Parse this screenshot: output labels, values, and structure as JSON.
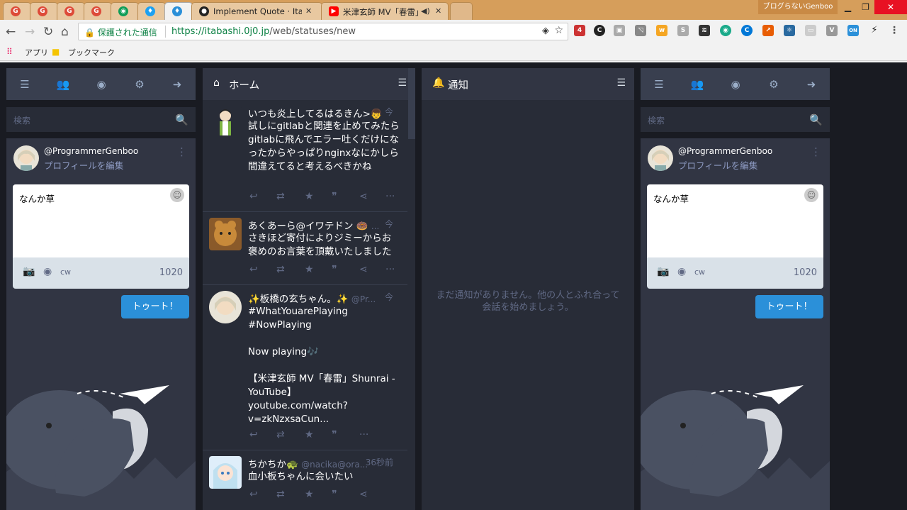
{
  "browser": {
    "tabs": [
      {
        "fav": "G",
        "title": ""
      },
      {
        "fav": "G",
        "title": ""
      },
      {
        "fav": "G",
        "title": ""
      },
      {
        "fav": "G",
        "title": ""
      },
      {
        "fav": "◉",
        "title": ""
      },
      {
        "fav": "♦",
        "title": ""
      },
      {
        "fav": "♦",
        "title": ""
      },
      {
        "fav": "●",
        "title": "Implement Quote · Ita"
      },
      {
        "fav": "▶",
        "title": "米津玄師 MV「春雷」S"
      }
    ],
    "window_user": "ブログらないGenboo",
    "secure_label": "保護された通信",
    "url_host": "https://itabashi.0j0.jp",
    "url_path": "/web/statuses/new",
    "bookmarks": [
      {
        "label": "アプリ"
      },
      {
        "label": "ブックマーク"
      }
    ]
  },
  "left_panel": {
    "search_placeholder": "検索",
    "username": "@ProgrammerGenboo",
    "edit_profile": "プロフィールを編集",
    "compose_text": "なんか草",
    "cw_label": "cw",
    "char_count": "1020",
    "toot_button": "トゥート！"
  },
  "home_column": {
    "title": "ホーム",
    "statuses": [
      {
        "display_name": "いつも炎上してるはるきん>👦",
        "account": "",
        "time": "今",
        "content": "試しにgitlabと関連を止めてみたらgitlabに飛んでエラー吐くだけになったからやっぱりnginxなにかしら間違えてると考えるべきかね"
      },
      {
        "display_name": "あくあーら@イワテドン 🍩",
        "account": "...",
        "time": "今",
        "content": "さきほど寄付によりジミーからお褒めのお言葉を頂戴いたしました"
      },
      {
        "display_name": "✨板橋の玄ちゃん。✨",
        "account": "@Pr...",
        "time": "今",
        "content": "#WhatYouarePlaying\n#NowPlaying\n\nNow playing🎶\n\n【米津玄師 MV「春雷」Shunrai - YouTube】\nyoutube.com/watch?v=zkNzxsaCun..."
      },
      {
        "display_name": "ちかちか🐢",
        "account": "@nacika@ora...",
        "time": "36秒前",
        "content": "血小板ちゃんに会いたい"
      }
    ]
  },
  "notif_column": {
    "title": "通知",
    "empty_message": "まだ通知がありません。他の人とふれ合って会話を始めましょう。"
  },
  "right_panel": {
    "search_placeholder": "検索",
    "username": "@ProgrammerGenboo",
    "edit_profile": "プロフィールを編集",
    "compose_text": "なんか草",
    "cw_label": "cw",
    "char_count": "1020",
    "toot_button": "トゥート！"
  },
  "colors": {
    "accent": "#2b90d9",
    "background": "#191b22",
    "column": "#282c37",
    "header": "#313543"
  }
}
